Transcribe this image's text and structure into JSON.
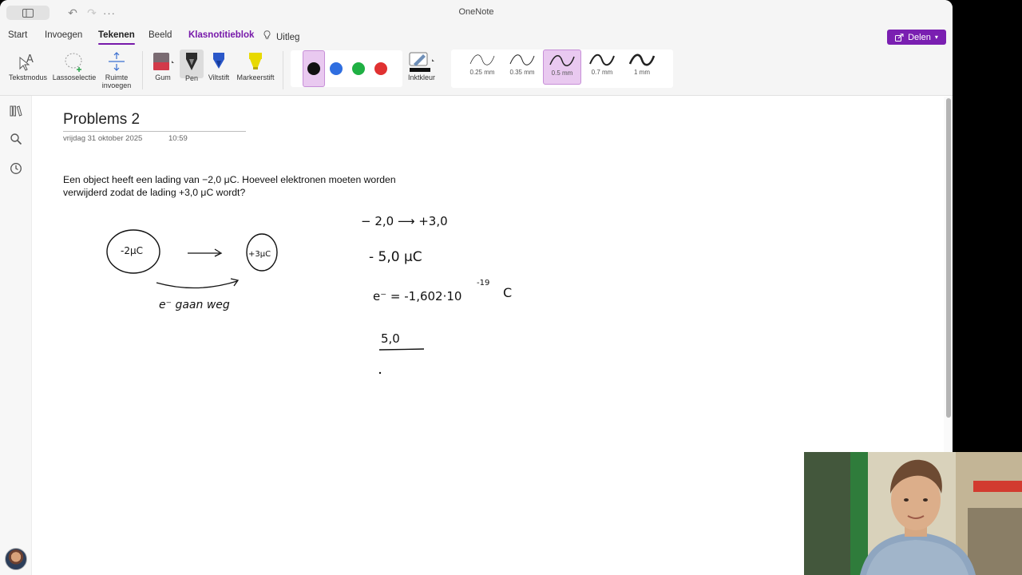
{
  "app": {
    "title": "OneNote"
  },
  "menu": {
    "tabs": [
      {
        "label": "Start"
      },
      {
        "label": "Invoegen"
      },
      {
        "label": "Tekenen"
      },
      {
        "label": "Beeld"
      },
      {
        "label": "Klasnotitieblok"
      },
      {
        "label": "Uitleg"
      }
    ],
    "active_tab": "Tekenen",
    "share_label": "Delen"
  },
  "ribbon": {
    "tools": {
      "text_mode": "Tekstmodus",
      "lasso": "Lassoselectie",
      "insert_space_1": "Ruimte",
      "insert_space_2": "invoegen",
      "eraser": "Gum",
      "pen": "Pen",
      "felt_tip": "Viltstift",
      "highlighter": "Markeerstift",
      "ink_color": "Inktkleur"
    },
    "colors": [
      "#111111",
      "#2f6ee0",
      "#1fb043",
      "#e03131"
    ],
    "selected_color": "#111111",
    "thicknesses": [
      {
        "label": "0.25 mm",
        "selected": false
      },
      {
        "label": "0.35 mm",
        "selected": false
      },
      {
        "label": "0.5 mm",
        "selected": true
      },
      {
        "label": "0.7 mm",
        "selected": false
      },
      {
        "label": "1 mm",
        "selected": false
      }
    ]
  },
  "page": {
    "title": "Problems 2",
    "date": "vrijdag 31 oktober 2025",
    "time": "10:59",
    "question_line1": "Een object heeft een lading van −2,0 μC. Hoeveel elektronen moeten worden",
    "question_line2": "verwijderd zodat de lading +3,0 μC wordt?"
  },
  "ink": {
    "left_charge": "-2μC",
    "right_charge": "+3μC",
    "electrons_label": "e⁻ gaan weg",
    "step1": "− 2,0 ⟶ +3,0",
    "step2": "- 5,0 μC",
    "step3_base": "e⁻ = -1,602·10",
    "step3_exp": "-19",
    "step3_unit": "C",
    "step4": "5,0"
  }
}
